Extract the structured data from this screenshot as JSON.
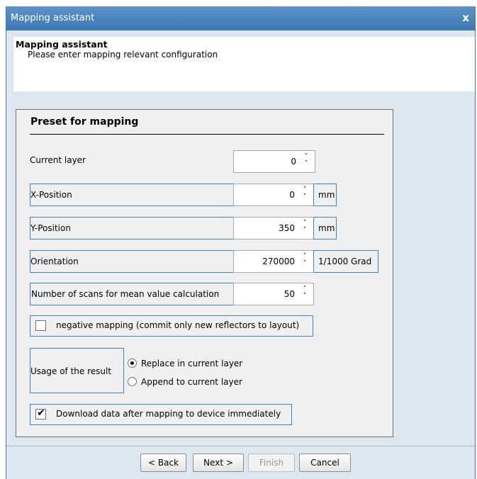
{
  "window": {
    "title": "Mapping assistant",
    "close_glyph": "x"
  },
  "header": {
    "title": "Mapping assistant",
    "subtitle": "Please enter mapping relevant configuration"
  },
  "panel": {
    "title": "Preset for mapping",
    "current_layer": {
      "label": "Current layer",
      "value": "0"
    },
    "x_position": {
      "label": "X-Position",
      "value": "0",
      "unit": "mm"
    },
    "y_position": {
      "label": "Y-Position",
      "value": "350",
      "unit": "mm"
    },
    "orientation": {
      "label": "Orientation",
      "value": "270000",
      "unit": "1/1000 Grad"
    },
    "num_scans": {
      "label": "Number of scans for mean value calculation",
      "value": "50"
    },
    "negative_mapping": {
      "label": "negative mapping (commit only new reflectors to layout)",
      "checked": false
    },
    "usage": {
      "label": "Usage of the result",
      "options": [
        "Replace in current layer",
        "Append to current layer"
      ],
      "selected": "Replace in current layer"
    },
    "download": {
      "label": "Download data after mapping to device immediately",
      "checked": true
    }
  },
  "spin_glyphs": {
    "up": "˄",
    "down": "˅"
  },
  "buttons": {
    "back": "< Back",
    "next": "Next >",
    "finish": "Finish",
    "cancel": "Cancel"
  }
}
